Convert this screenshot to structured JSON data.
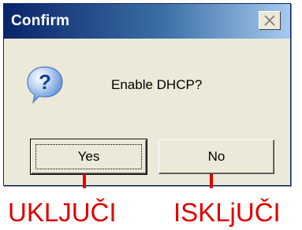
{
  "dialog": {
    "title": "Confirm",
    "message": "Enable DHCP?",
    "icon": "question-icon",
    "icon_glyph": "?",
    "buttons": {
      "yes_label": "Yes",
      "no_label": "No"
    }
  },
  "annotations": {
    "yes_text": "UKLJUČI",
    "no_text": "ISKLjUČI"
  },
  "colors": {
    "titlebar_start": "#0a246a",
    "titlebar_end": "#a6caf0",
    "dialog_face": "#ece9d8",
    "annotation_red": "#e00000",
    "icon_blue": "#1f5fbf"
  }
}
